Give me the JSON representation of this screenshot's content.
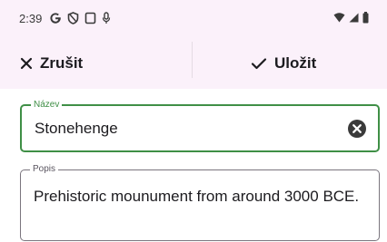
{
  "status_bar": {
    "time": "2:39",
    "left_icons": [
      "google-icon",
      "shield-icon",
      "screen-icon",
      "mic-icon"
    ],
    "right_icons": [
      "wifi-icon",
      "signal-icon",
      "battery-icon"
    ]
  },
  "app_bar": {
    "cancel_label": "Zrušit",
    "save_label": "Uložit",
    "cancel_icon": "close-icon",
    "save_icon": "check-icon"
  },
  "form": {
    "name_label": "Název",
    "name_value": "Stonehenge",
    "description_label": "Popis",
    "description_value": "Prehistoric mounument from around 3000 BCE."
  },
  "colors": {
    "bar_background": "#fbf1fa",
    "focus_accent": "#3f8f46"
  }
}
